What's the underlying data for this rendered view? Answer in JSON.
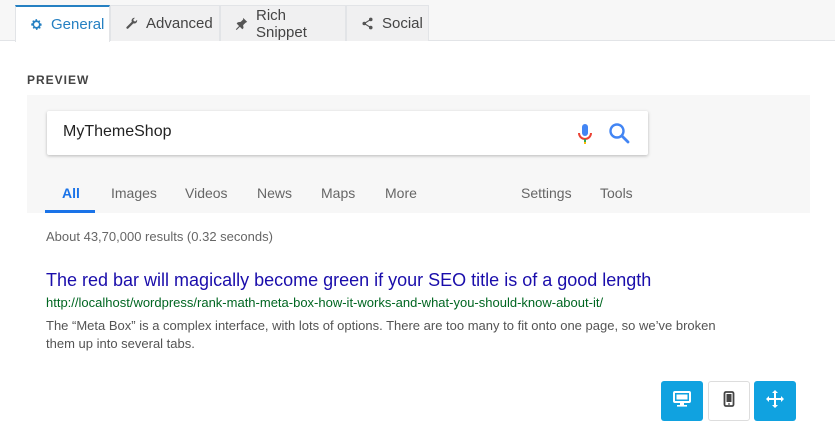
{
  "tabs": [
    {
      "label": "General",
      "icon": "gear-icon",
      "active": true
    },
    {
      "label": "Advanced",
      "icon": "wrench-icon"
    },
    {
      "label": "Rich Snippet",
      "icon": "pin-icon"
    },
    {
      "label": "Social",
      "icon": "share-icon"
    }
  ],
  "preview": {
    "label": "PREVIEW",
    "search_query": "MyThemeShop",
    "nav": [
      "All",
      "Images",
      "Videos",
      "News",
      "Maps",
      "More",
      "Settings",
      "Tools"
    ],
    "active_nav": "All",
    "results_count": "About 43,70,000 results (0.32 seconds)",
    "result": {
      "title": "The red bar will magically become green if your SEO title is of a good length",
      "url": "http://localhost/wordpress/rank-math-meta-box-how-it-works-and-what-you-should-know-about-it/",
      "description": "The “Meta Box” is a complex interface, with lots of options. There are too many to fit onto one page, so we’ve broken them up into several tabs."
    }
  },
  "device_buttons": [
    {
      "icon": "desktop-icon",
      "active": true
    },
    {
      "icon": "mobile-icon",
      "active": false
    },
    {
      "icon": "expand-icon",
      "active": true
    }
  ],
  "colors": {
    "accent": "#2580c2",
    "button": "#10a2e0",
    "link": "#1a0dab",
    "url": "#006621"
  }
}
